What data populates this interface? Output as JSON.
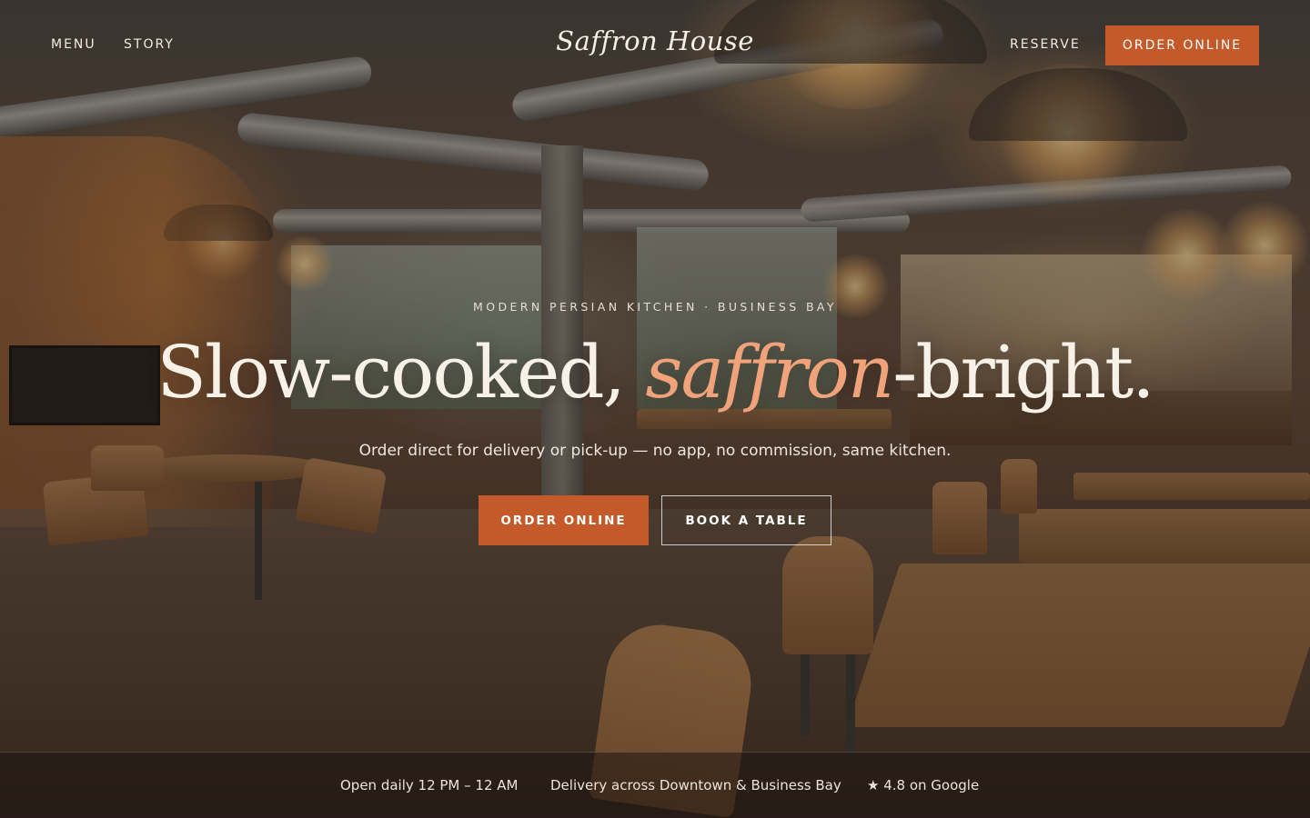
{
  "nav": {
    "menu_label": "MENU",
    "story_label": "STORY",
    "logo_text": "Saffron House",
    "reserve_label": "RESERVE",
    "order_label": "ORDER ONLINE"
  },
  "hero": {
    "eyebrow": "MODERN PERSIAN KITCHEN · BUSINESS BAY",
    "headline_part1": "Slow-cooked, ",
    "headline_accent": "saffron",
    "headline_part2": "-bright.",
    "subline": "Order direct for delivery or pick-up — no app, no commission, same kitchen.",
    "primary_cta": "ORDER ONLINE",
    "secondary_cta": "BOOK A TABLE"
  },
  "info_bar": {
    "hours": "Open daily 12 PM – 12 AM",
    "delivery": "Delivery across Downtown & Business Bay",
    "rating": "★ 4.8 on Google"
  },
  "colors": {
    "accent": "#c45a2a",
    "headline_accent": "#f0a27a",
    "text_light": "#f8f1e8"
  }
}
